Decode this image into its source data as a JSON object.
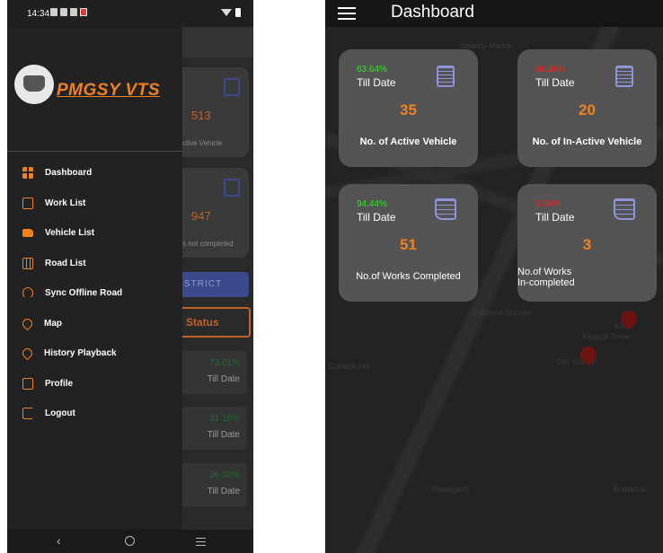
{
  "left_screen": {
    "status_time": "14:34",
    "brand": "PMGSY VTS",
    "menu": [
      {
        "label": "Dashboard",
        "icon": "grid-icon"
      },
      {
        "label": "Work List",
        "icon": "work-list-icon"
      },
      {
        "label": "Vehicle List",
        "icon": "truck-icon"
      },
      {
        "label": "Road List",
        "icon": "road-icon"
      },
      {
        "label": "Sync Offline Road",
        "icon": "sync-icon"
      },
      {
        "label": "Map",
        "icon": "map-icon"
      },
      {
        "label": "History Playback",
        "icon": "history-icon"
      },
      {
        "label": "Profile",
        "icon": "profile-icon"
      },
      {
        "label": "Logout",
        "icon": "logout-icon"
      }
    ],
    "background": {
      "card1_value": "513",
      "card1_caption": "ctive Vehicle",
      "card2_value": "947",
      "card2_caption": "s not completed",
      "district_btn": "STRICT",
      "status_btn": "Status",
      "rows": [
        {
          "pct": "73.01%",
          "till": "Till Date"
        },
        {
          "pct": "31.15%",
          "till": "Till Date"
        },
        {
          "pct": "26.92%",
          "till": "Till Date"
        }
      ]
    },
    "nav": {
      "back": "‹"
    }
  },
  "right_screen": {
    "title": "Dashboard",
    "cards": [
      {
        "pct": "63.64%",
        "till": "Till Date",
        "value": "35",
        "caption": "No. of Active Vehicle",
        "pct_color": "#2ee51e"
      },
      {
        "pct": "36.36%",
        "till": "Till Date",
        "value": "20",
        "caption": "No. of In-Active Vehicle",
        "pct_color": "#ff1d1d"
      },
      {
        "pct": "94.44%",
        "till": "Till Date",
        "value": "51",
        "caption": "No.of Works Completed",
        "pct_color": "#2ee51e"
      },
      {
        "pct": "5.56%",
        "till": "Till Date",
        "value": "3",
        "caption": "No.of Works\nIn-completed",
        "pct_color": "#ff1d1d"
      }
    ],
    "map_labels": [
      "Swamy Mandir",
      "Kuhi",
      "Kalpana Square",
      "Khurda Tower",
      "Cuttack Hill",
      "Old Station",
      "Rasulgarh",
      "Bomikhal"
    ]
  }
}
